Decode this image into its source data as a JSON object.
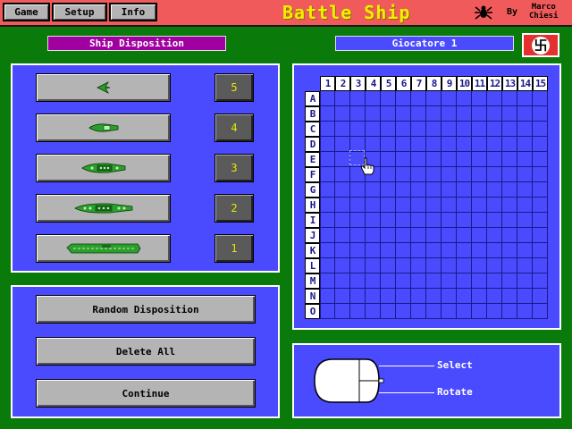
{
  "menu": {
    "game": "Game",
    "setup": "Setup",
    "info": "Info"
  },
  "header": {
    "title": "Battle Ship",
    "by": "By",
    "author_first": "Marco",
    "author_last": "Chiesi"
  },
  "section_label": "Ship Disposition",
  "player_label": "Giocatore 1",
  "colors": {
    "bg_green": "#0a7a0a",
    "panel_blue": "#4a4aff",
    "topbar_red": "#f05a5a",
    "title_yellow": "#f0f000",
    "section_magenta": "#a000a0",
    "ship_green": "#2aa02a"
  },
  "ships": [
    {
      "name": "plane",
      "count": "5",
      "icon": "plane-icon"
    },
    {
      "name": "submarine",
      "count": "4",
      "icon": "submarine-icon"
    },
    {
      "name": "destroyer",
      "count": "3",
      "icon": "destroyer-icon"
    },
    {
      "name": "cruiser",
      "count": "2",
      "icon": "cruiser-icon"
    },
    {
      "name": "carrier",
      "count": "1",
      "icon": "carrier-icon"
    }
  ],
  "actions": {
    "random": "Random Disposition",
    "delete": "Delete All",
    "continue": "Continue"
  },
  "grid": {
    "columns": [
      "1",
      "2",
      "3",
      "4",
      "5",
      "6",
      "7",
      "8",
      "9",
      "10",
      "11",
      "12",
      "13",
      "14",
      "15"
    ],
    "rows": [
      "A",
      "B",
      "C",
      "D",
      "E",
      "F",
      "G",
      "H",
      "I",
      "J",
      "K",
      "L",
      "M",
      "N",
      "O"
    ]
  },
  "mouse_legend": {
    "select": "Select",
    "rotate": "Rotate"
  }
}
